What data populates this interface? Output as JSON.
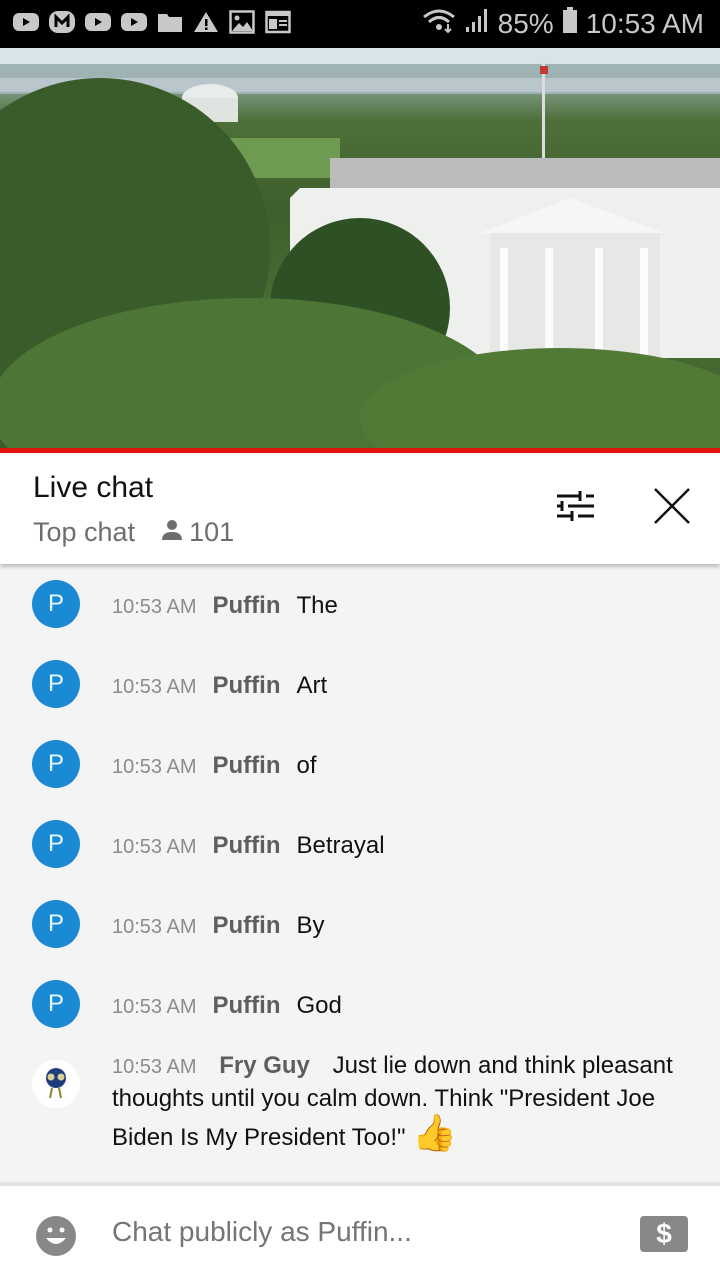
{
  "status_bar": {
    "notification_icons": [
      "youtube-icon",
      "m-app-icon",
      "youtube-icon",
      "youtube-icon",
      "folder-icon",
      "warning-icon",
      "image-icon",
      "news-icon"
    ],
    "battery": "85%",
    "time": "10:53 AM"
  },
  "video": {
    "description": "White House live camera",
    "progress_color": "#e0140c"
  },
  "header": {
    "title": "Live chat",
    "mode": "Top chat",
    "viewers": "101"
  },
  "messages": [
    {
      "time": "10:53 AM",
      "author": "Puffin",
      "avatar_letter": "P",
      "text": "The"
    },
    {
      "time": "10:53 AM",
      "author": "Puffin",
      "avatar_letter": "P",
      "text": "Art"
    },
    {
      "time": "10:53 AM",
      "author": "Puffin",
      "avatar_letter": "P",
      "text": "of"
    },
    {
      "time": "10:53 AM",
      "author": "Puffin",
      "avatar_letter": "P",
      "text": "Betrayal"
    },
    {
      "time": "10:53 AM",
      "author": "Puffin",
      "avatar_letter": "P",
      "text": "By"
    },
    {
      "time": "10:53 AM",
      "author": "Puffin",
      "avatar_letter": "P",
      "text": "God"
    },
    {
      "time": "10:53 AM",
      "author": "Fry Guy",
      "avatar_letter": "",
      "text": "Just lie down and think pleasant thoughts until you calm down. Think \"President Joe Biden Is My President Too!\"",
      "emoji": "👍"
    }
  ],
  "footer": {
    "placeholder": "Chat publicly as Puffin...",
    "money_symbol": "$"
  },
  "colors": {
    "avatar_blue": "#1a8ad4",
    "accent_red": "#e0140c"
  }
}
